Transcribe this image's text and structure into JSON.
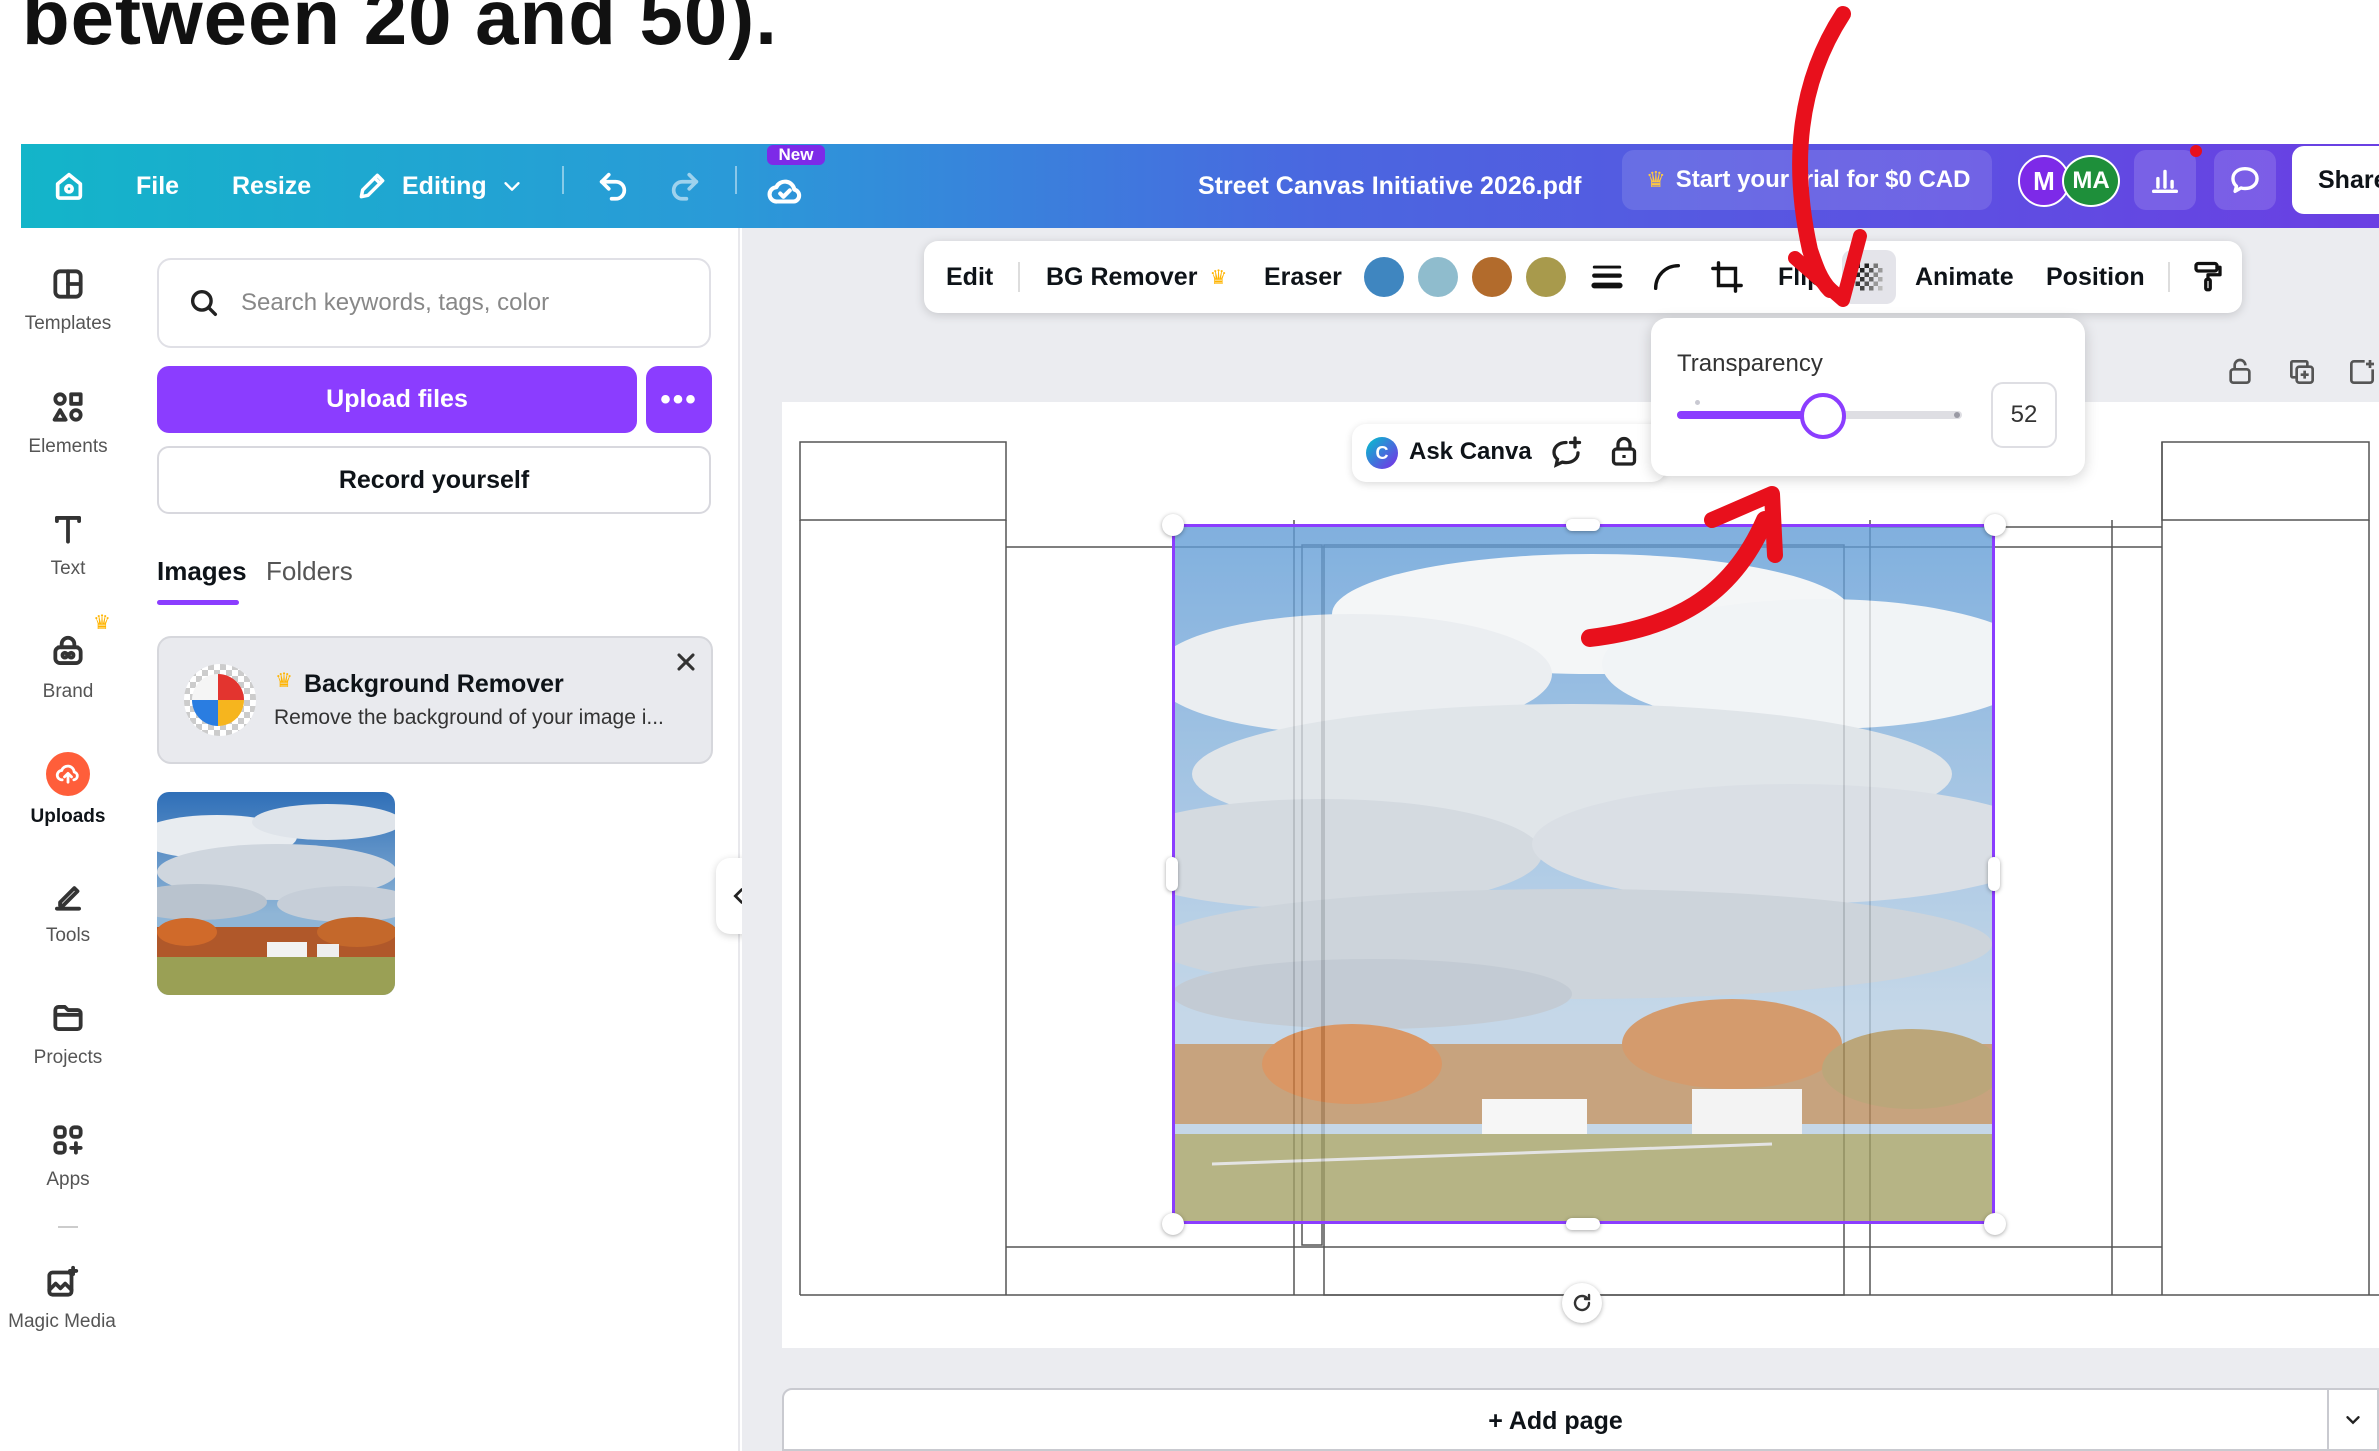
{
  "heading": {
    "text": "between 20 and 50)."
  },
  "topbar": {
    "file": "File",
    "resize": "Resize",
    "editing": "Editing",
    "new_badge": "New",
    "document_title": "Street Canvas Initiative 2026.pdf",
    "trial_text": "Start your trial for $0 CAD",
    "avatar_1": "M",
    "avatar_2": "MA",
    "share": "Share"
  },
  "rail": {
    "items": [
      {
        "label": "Templates",
        "icon": "templates-icon"
      },
      {
        "label": "Elements",
        "icon": "elements-icon"
      },
      {
        "label": "Text",
        "icon": "text-icon"
      },
      {
        "label": "Brand",
        "icon": "brand-icon"
      },
      {
        "label": "Uploads",
        "icon": "uploads-icon"
      },
      {
        "label": "Tools",
        "icon": "tools-icon"
      },
      {
        "label": "Projects",
        "icon": "projects-icon"
      },
      {
        "label": "Apps",
        "icon": "apps-icon"
      },
      {
        "label": "Magic Media",
        "icon": "magic-media-icon"
      }
    ]
  },
  "panel": {
    "search_placeholder": "Search keywords, tags, color",
    "upload_files": "Upload files",
    "more": "•••",
    "record_yourself": "Record yourself",
    "tabs": [
      "Images",
      "Folders"
    ],
    "promo": {
      "title": "Background Remover",
      "description": "Remove the background of your image i..."
    }
  },
  "context_toolbar": {
    "edit": "Edit",
    "bg_remover": "BG Remover",
    "eraser": "Eraser",
    "flip": "Flip",
    "animate": "Animate",
    "position": "Position",
    "swatches": [
      "#3f86c0",
      "#8fbccd",
      "#b26b2c",
      "#a89a4c"
    ]
  },
  "transparency": {
    "label": "Transparency",
    "value": "52",
    "level": 52
  },
  "ask_canva": {
    "label": "Ask Canva"
  },
  "add_page": {
    "label": "+ Add page"
  },
  "colors": {
    "accent": "#8b3dff",
    "annotation": "#e8101c",
    "avatar_1": "#7d2ae8",
    "avatar_2": "#1e8f3a"
  }
}
